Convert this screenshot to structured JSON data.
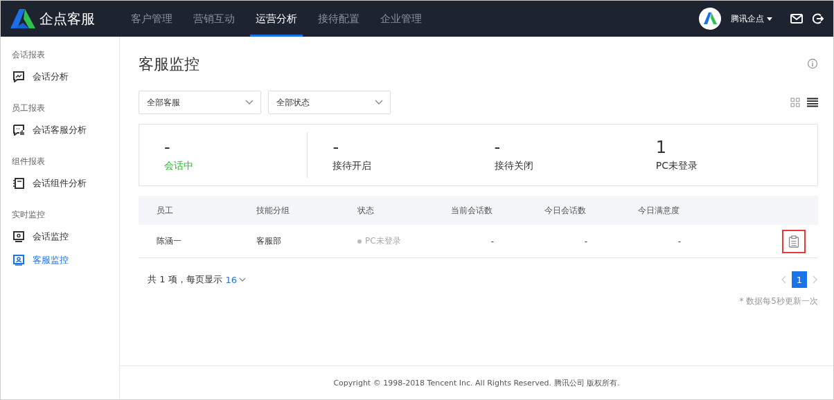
{
  "header": {
    "brand": "企点客服",
    "nav": [
      {
        "label": "客户管理",
        "selected": false
      },
      {
        "label": "营销互动",
        "selected": false
      },
      {
        "label": "运营分析",
        "selected": true
      },
      {
        "label": "接待配置",
        "selected": false
      },
      {
        "label": "企业管理",
        "selected": false
      }
    ],
    "account": "腾讯企点"
  },
  "sidebar": [
    {
      "heading": "会话报表",
      "items": [
        {
          "label": "会话分析",
          "kind": "chart",
          "selected": false
        }
      ]
    },
    {
      "heading": "员工报表",
      "items": [
        {
          "label": "会话客服分析",
          "kind": "bars",
          "selected": false
        }
      ]
    },
    {
      "heading": "组件报表",
      "items": [
        {
          "label": "会话组件分析",
          "kind": "notebook",
          "selected": false
        }
      ]
    },
    {
      "heading": "实时监控",
      "items": [
        {
          "label": "会话监控",
          "kind": "monitor",
          "selected": false
        },
        {
          "label": "客服监控",
          "kind": "badge",
          "selected": true
        }
      ]
    }
  ],
  "page_title": "客服监控",
  "filters": [
    {
      "value": "全部客服"
    },
    {
      "value": "全部状态"
    }
  ],
  "views": [
    {
      "kind": "grid",
      "selected": false
    },
    {
      "kind": "list",
      "selected": true
    }
  ],
  "stats": [
    {
      "value": "-",
      "label": "会话中",
      "color": "#2db82d"
    },
    {
      "value": "-",
      "label": "接待开启",
      "color": "#333333"
    },
    {
      "value": "-",
      "label": "接待关闭",
      "color": "#333333"
    },
    {
      "value": "1",
      "label": "PC未登录",
      "color": "#333333"
    }
  ],
  "table": {
    "columns": [
      "员工",
      "技能分组",
      "状态",
      "当前会话数",
      "今日会话数",
      "今日满意度"
    ],
    "rows": [
      {
        "employee": "陈涵一",
        "group": "客服部",
        "status": "PC未登录",
        "current": "-",
        "today": "-",
        "satisfaction": "-",
        "highlighted": true
      }
    ]
  },
  "pagination": {
    "summary": "共 1 项，每页显示",
    "page_size": "16",
    "pages": [
      {
        "label": "1",
        "selected": true
      }
    ]
  },
  "update_note": "* 数据每5秒更新一次",
  "footer": "Copyright © 1998-2018 Tencent Inc. All Rights Reserved. 腾讯公司 版权所有."
}
